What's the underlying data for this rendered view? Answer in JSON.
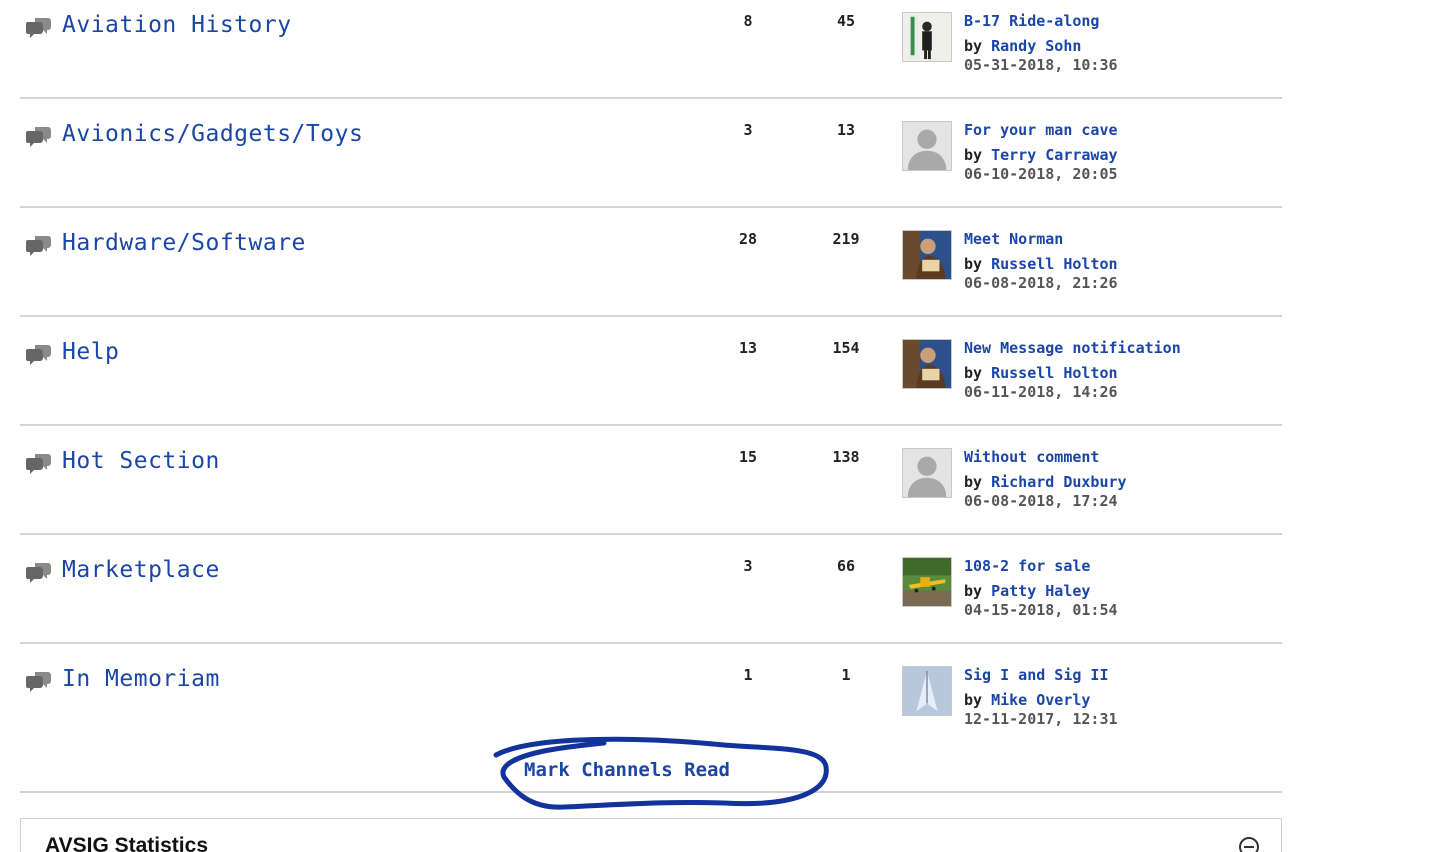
{
  "channels": [
    {
      "title": "Aviation History",
      "topics": "8",
      "posts": "45",
      "last": {
        "title": "B-17 Ride-along",
        "by": "by",
        "author": "Randy Sohn",
        "date": "05-31-2018, 10:36",
        "avatar": "photo-person"
      }
    },
    {
      "title": "Avionics/Gadgets/Toys",
      "topics": "3",
      "posts": "13",
      "last": {
        "title": "For your man cave",
        "by": "by",
        "author": "Terry Carraway",
        "date": "06-10-2018, 20:05",
        "avatar": "default-avatar"
      }
    },
    {
      "title": "Hardware/Software",
      "topics": "28",
      "posts": "219",
      "last": {
        "title": "Meet Norman",
        "by": "by",
        "author": "Russell Holton",
        "date": "06-08-2018, 21:26",
        "avatar": "photo-portrait"
      }
    },
    {
      "title": "Help",
      "topics": "13",
      "posts": "154",
      "last": {
        "title": "New Message notification",
        "by": "by",
        "author": "Russell Holton",
        "date": "06-11-2018, 14:26",
        "avatar": "photo-portrait"
      }
    },
    {
      "title": "Hot Section",
      "topics": "15",
      "posts": "138",
      "last": {
        "title": "Without comment",
        "by": "by",
        "author": "Richard Duxbury",
        "date": "06-08-2018, 17:24",
        "avatar": "default-avatar"
      }
    },
    {
      "title": "Marketplace",
      "topics": "3",
      "posts": "66",
      "last": {
        "title": "108-2 for sale",
        "by": "by",
        "author": "Patty Haley",
        "date": "04-15-2018, 01:54",
        "avatar": "photo-airplane"
      }
    },
    {
      "title": "In Memoriam",
      "topics": "1",
      "posts": "1",
      "last": {
        "title": "Sig I and Sig II",
        "by": "by",
        "author": "Mike Overly",
        "date": "12-11-2017, 12:31",
        "avatar": "photo-paper-plane"
      }
    }
  ],
  "mark_channels_label": "Mark Channels Read",
  "stats_title": "AVSIG Statistics",
  "colors": {
    "link": "#1b46a6",
    "divider": "#d4d4d4",
    "annotation": "#12329c"
  }
}
